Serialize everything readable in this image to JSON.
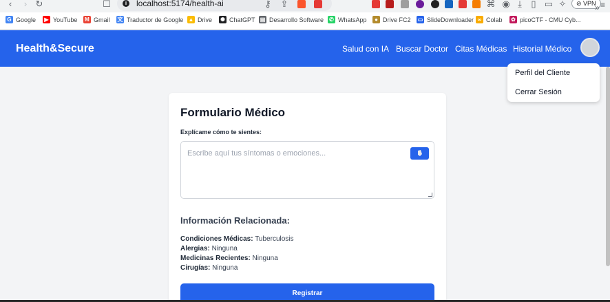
{
  "browser": {
    "url": "localhost:5174/health-ai",
    "vpn_label": "VPN",
    "bookmarks": [
      {
        "label": "Google",
        "icon": "google-icon",
        "color": "#4285f4",
        "glyph": "G"
      },
      {
        "label": "YouTube",
        "icon": "youtube-icon",
        "color": "#ff0000",
        "glyph": "▶"
      },
      {
        "label": "Gmail",
        "icon": "gmail-icon",
        "color": "#ea4335",
        "glyph": "M"
      },
      {
        "label": "Traductor de Google",
        "icon": "translate-icon",
        "color": "#4285f4",
        "glyph": "文"
      },
      {
        "label": "Drive",
        "icon": "drive-icon",
        "color": "#fbbc04",
        "glyph": "▲"
      },
      {
        "label": "ChatGPT",
        "icon": "chatgpt-icon",
        "color": "#202124",
        "glyph": "✺"
      },
      {
        "label": "Desarrollo Software",
        "icon": "document-icon",
        "color": "#5f6368",
        "glyph": "▤"
      },
      {
        "label": "WhatsApp",
        "icon": "whatsapp-icon",
        "color": "#25d366",
        "glyph": "✆"
      },
      {
        "label": "Drive FC2",
        "icon": "drive-fc2-icon",
        "color": "#b38b2d",
        "glyph": "●"
      },
      {
        "label": "SlideDownloader",
        "icon": "slide-icon",
        "color": "#2563eb",
        "glyph": "▭"
      },
      {
        "label": "Colab",
        "icon": "colab-icon",
        "color": "#f9ab00",
        "glyph": "∞"
      },
      {
        "label": "picoCTF - CMU Cyb...",
        "icon": "picoctf-icon",
        "color": "#c2185b",
        "glyph": "✿"
      }
    ]
  },
  "header": {
    "brand": "Health&Secure",
    "nav": [
      "Salud con IA",
      "Buscar Doctor",
      "Citas Médicas",
      "Historial Médico"
    ],
    "color": "#2563eb"
  },
  "dropdown": {
    "items": [
      "Perfil del Cliente",
      "Cerrar Sesión"
    ]
  },
  "form": {
    "title": "Formulario Médico",
    "field_label": "Explícame cómo te sientes:",
    "placeholder": "Escribe aquí tus síntomas o emociones...",
    "section_title": "Información Relacionada:",
    "info": [
      {
        "label": "Condiciones Médicas:",
        "value": "Tuberculosis"
      },
      {
        "label": "Alergias:",
        "value": "Ninguna"
      },
      {
        "label": "Medicinas Recientes:",
        "value": "Ninguna"
      },
      {
        "label": "Cirugías:",
        "value": "Ninguna"
      }
    ],
    "submit_label": "Registrar"
  }
}
